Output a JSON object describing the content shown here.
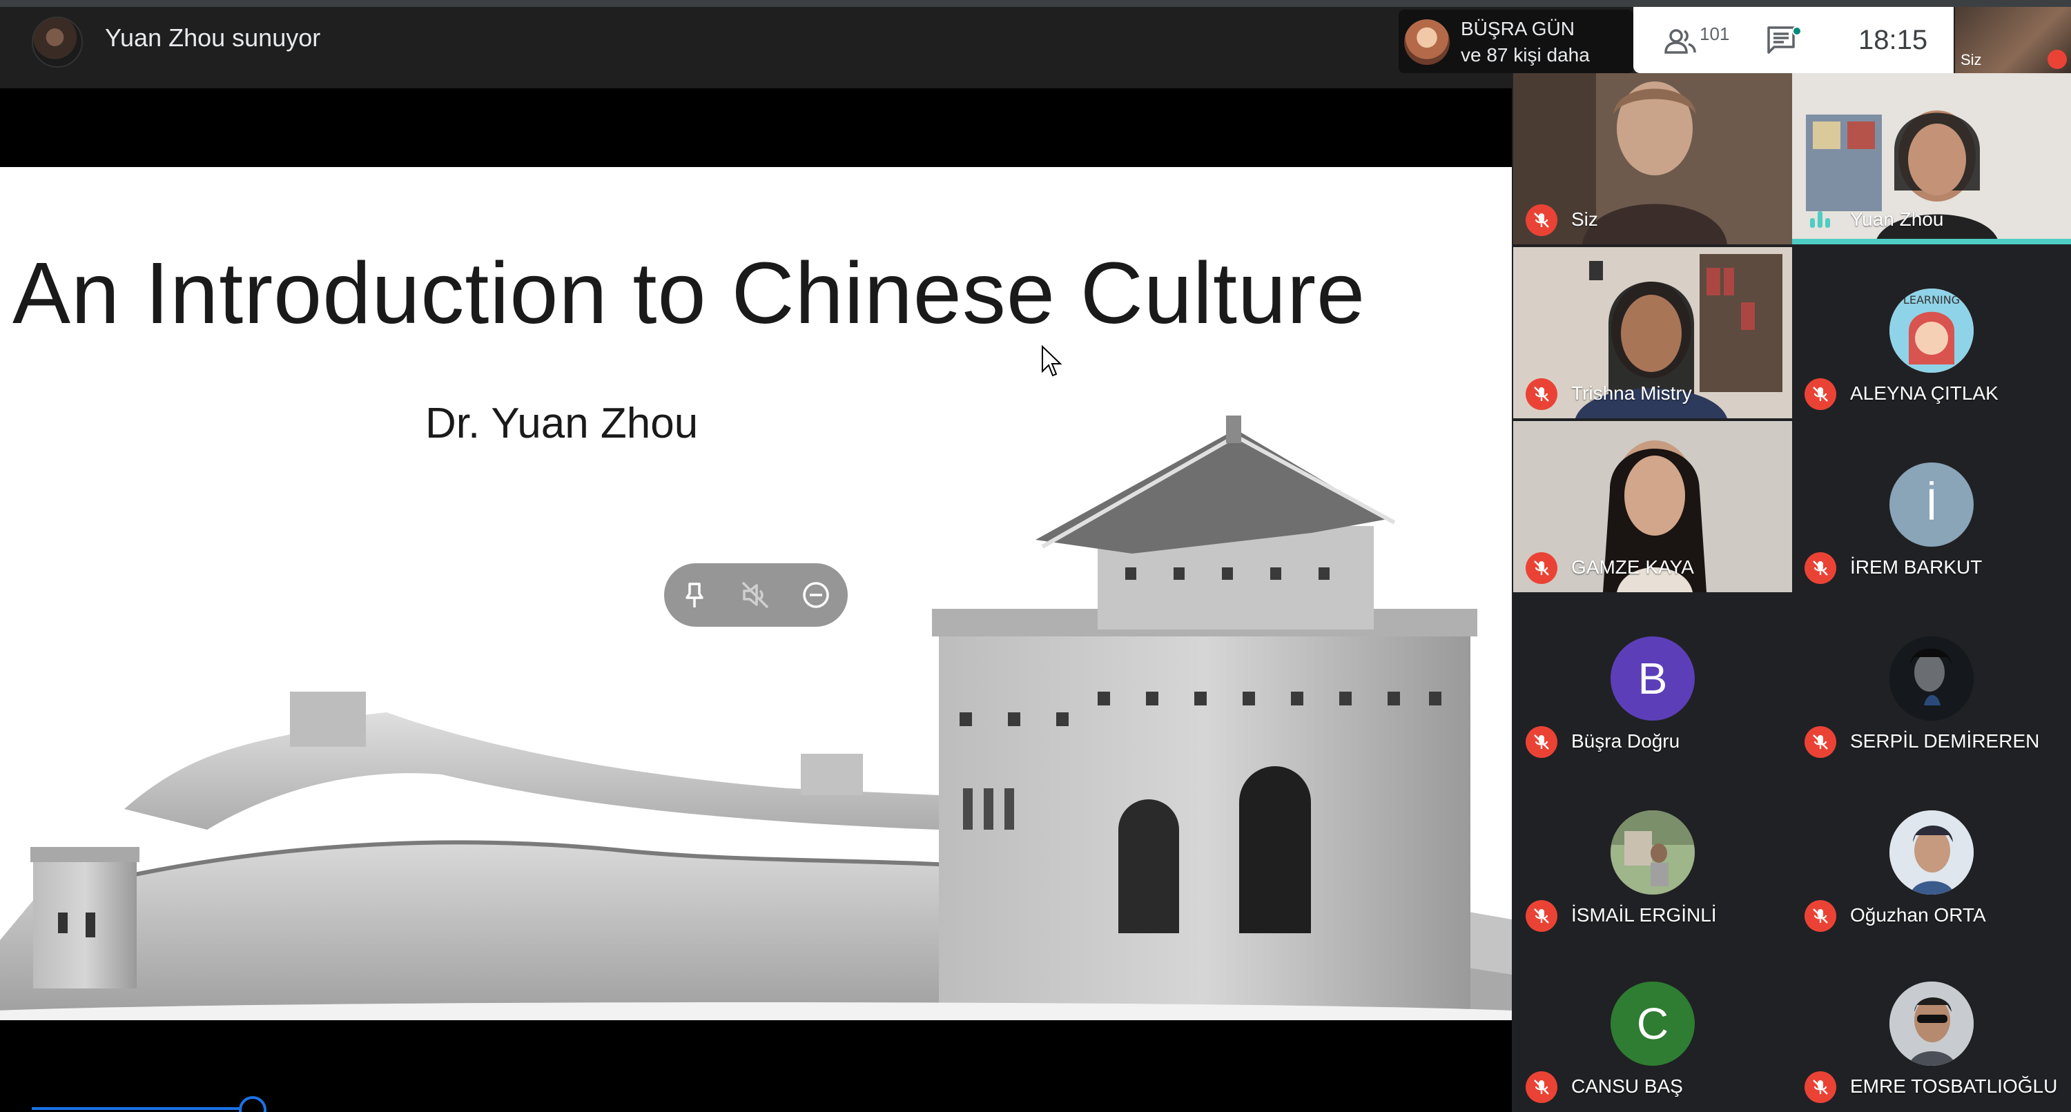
{
  "presenter": {
    "label": "Yuan Zhou sunuyor"
  },
  "active_speaker": {
    "name": "BÜŞRA GÜN",
    "subtitle": "ve 87 kişi daha"
  },
  "toolbar": {
    "people_count": "101",
    "clock": "18:15"
  },
  "self_preview": {
    "label": "Siz"
  },
  "slide": {
    "title": "An Introduction to Chinese Culture",
    "author": "Dr. Yuan Zhou"
  },
  "participants": [
    {
      "name": "Siz",
      "type": "video"
    },
    {
      "name": "Yuan Zhou",
      "type": "video",
      "speaking": true
    },
    {
      "name": "Trishna Mistry",
      "type": "video"
    },
    {
      "name": "ALEYNA ÇITLAK",
      "type": "avatar-image"
    },
    {
      "name": "GAMZE KAYA",
      "type": "video"
    },
    {
      "name": "İREM BARKUT",
      "type": "letter",
      "initial": "İ",
      "color": "#8aa4b8"
    },
    {
      "name": "Büşra Doğru",
      "type": "letter",
      "initial": "B",
      "color": "#5c3fb8"
    },
    {
      "name": "SERPİL DEMİREREN",
      "type": "avatar-image"
    },
    {
      "name": "İSMAİL ERGİNLİ",
      "type": "avatar-image"
    },
    {
      "name": "Oğuzhan ORTA",
      "type": "avatar-image"
    },
    {
      "name": "CANSU BAŞ",
      "type": "letter",
      "initial": "C",
      "color": "#2e7d32"
    },
    {
      "name": "EMRE TOSBATLIOĞLU",
      "type": "avatar-image"
    }
  ],
  "colors": {
    "mic_muted": "#ea4335",
    "speaking": "#4ecdc4",
    "accent": "#1a73e8"
  },
  "icons": [
    "people-icon",
    "chat-icon",
    "pin-icon",
    "mute-icon",
    "remove-icon",
    "mic-off-icon"
  ]
}
